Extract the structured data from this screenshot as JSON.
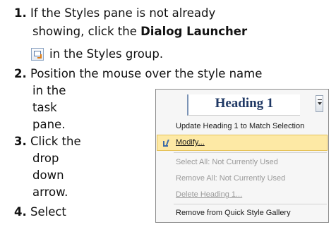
{
  "steps": [
    {
      "number": "1.",
      "lines": [
        "If the Styles pane is not already",
        "showing, click the ",
        "Dialog Launcher",
        "in the Styles group."
      ]
    },
    {
      "number": "2.",
      "lines": [
        "Position the mouse over the style name",
        "in the",
        "task",
        "pane."
      ]
    },
    {
      "number": "3.",
      "lines": [
        "Click the",
        "drop",
        "down",
        "arrow."
      ]
    },
    {
      "number": "4.",
      "lines": [
        "Select"
      ]
    }
  ],
  "menu": {
    "style_name": "Heading 1",
    "items": [
      {
        "label": "Update Heading 1 to Match Selection",
        "state": "normal"
      },
      {
        "label": "Modify...",
        "state": "highlighted"
      },
      {
        "label": "Select All: Not Currently Used",
        "state": "disabled"
      },
      {
        "label": "Remove All: Not Currently Used",
        "state": "disabled"
      },
      {
        "label": "Delete Heading 1...",
        "state": "disabled"
      },
      {
        "label": "Remove from Quick Style Gallery",
        "state": "normal"
      }
    ]
  },
  "icons": {
    "dialog_launcher": "dialog-launcher-icon",
    "modify": "modify-style-icon",
    "dropdown": "dropdown-arrow-icon"
  }
}
